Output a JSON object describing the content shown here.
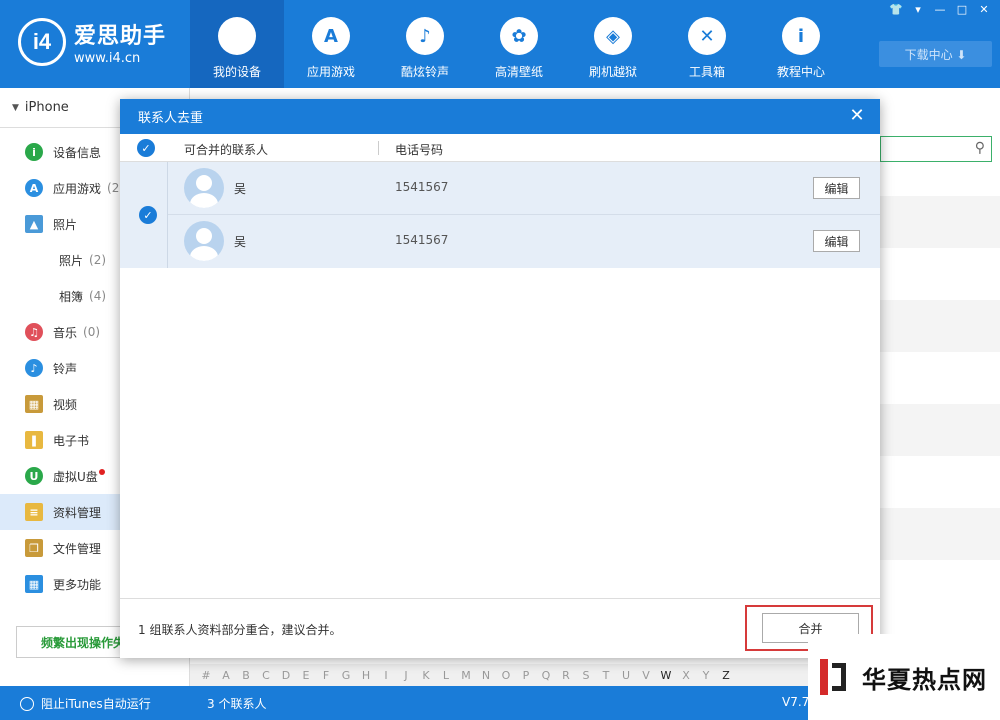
{
  "app": {
    "logo_badge": "i4",
    "logo_title": "爱思助手",
    "logo_url": "www.i4.cn",
    "brand_color": "#1a7cd8"
  },
  "nav": {
    "items": [
      {
        "label": "我的设备",
        "icon": "apple-icon",
        "glyph": "",
        "active": true
      },
      {
        "label": "应用游戏",
        "icon": "app-store-icon",
        "glyph": "A"
      },
      {
        "label": "酷炫铃声",
        "icon": "bell-icon",
        "glyph": "♪"
      },
      {
        "label": "高清壁纸",
        "icon": "flower-icon",
        "glyph": "✿"
      },
      {
        "label": "刷机越狱",
        "icon": "box-icon",
        "glyph": "◈"
      },
      {
        "label": "工具箱",
        "icon": "tools-icon",
        "glyph": "✕"
      },
      {
        "label": "教程中心",
        "icon": "info-icon",
        "glyph": "i"
      }
    ]
  },
  "window_controls": [
    "👕",
    "▾",
    "—",
    "□",
    "✕"
  ],
  "download_btn": "下载中心 ⬇",
  "sidebar": {
    "device": "iPhone",
    "items": [
      {
        "label": "设备信息",
        "count": "",
        "icon_color": "#2aa84a",
        "glyph": "i"
      },
      {
        "label": "应用游戏",
        "count": "(2",
        "icon_color": "#2b8fe0",
        "glyph": "A"
      },
      {
        "label": "照片",
        "count": "",
        "icon_color": "#4a9ad8",
        "glyph": "▲"
      },
      {
        "label": "照片",
        "count": "(2)",
        "sub": true
      },
      {
        "label": "相簿",
        "count": "(4)",
        "sub": true
      },
      {
        "label": "音乐",
        "count": "(0)",
        "icon_color": "#e0505a",
        "glyph": "♫"
      },
      {
        "label": "铃声",
        "count": "",
        "icon_color": "#2b8fe0",
        "glyph": "♪"
      },
      {
        "label": "视频",
        "count": "",
        "icon_color": "#c89a3a",
        "glyph": "▦"
      },
      {
        "label": "电子书",
        "count": "",
        "icon_color": "#e8b840",
        "glyph": "❚"
      },
      {
        "label": "虚拟U盘",
        "count": "",
        "icon_color": "#2aa84a",
        "glyph": "U",
        "dot": true
      },
      {
        "label": "资料管理",
        "count": "",
        "icon_color": "#e8b840",
        "glyph": "≡",
        "active": true
      },
      {
        "label": "文件管理",
        "count": "",
        "icon_color": "#c89a3a",
        "glyph": "❐"
      },
      {
        "label": "更多功能",
        "count": "",
        "icon_color": "#2b8fe0",
        "glyph": "▦"
      }
    ],
    "freq_btn": "频繁出现操作失"
  },
  "alphabet": [
    "#",
    "A",
    "B",
    "C",
    "D",
    "E",
    "F",
    "G",
    "H",
    "I",
    "J",
    "K",
    "L",
    "M",
    "N",
    "O",
    "P",
    "Q",
    "R",
    "S",
    "T",
    "U",
    "V",
    "W",
    "X",
    "Y",
    "Z"
  ],
  "alphabet_active": [
    "W",
    "Z"
  ],
  "statusbar": {
    "itunes": "阻止iTunes自动运行",
    "count": "3 个联系人",
    "version": "V7.7"
  },
  "dialog": {
    "title": "联系人去重",
    "close": "✕",
    "col_mergeable": "可合并的联系人",
    "col_phone": "电话号码",
    "rows": [
      {
        "name": "吴",
        "phone": "1541567",
        "edit": "编辑"
      },
      {
        "name": "吴",
        "phone": "1541567",
        "edit": "编辑"
      }
    ],
    "footer_msg": "1 组联系人资料部分重合，建议合并。",
    "merge_btn": "合并"
  },
  "watermark": "华夏热点网"
}
